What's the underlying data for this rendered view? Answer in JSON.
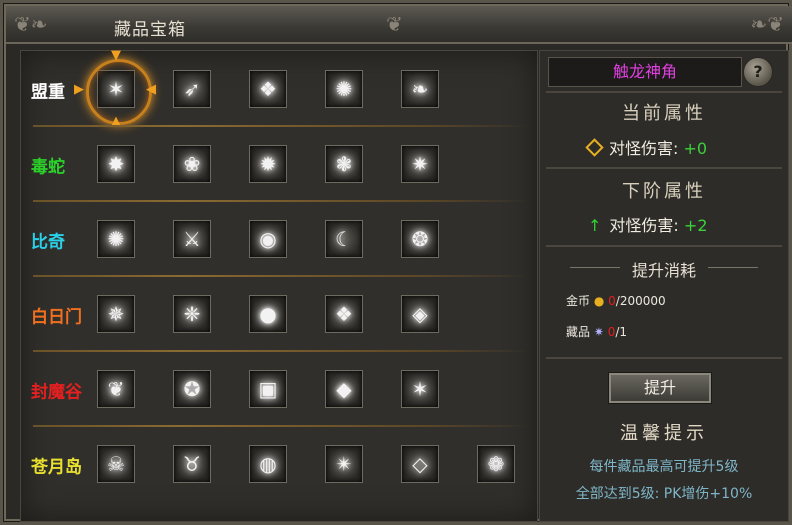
{
  "window": {
    "title": "藏品宝箱"
  },
  "rows": [
    {
      "name": "盟重",
      "color": "#ffffff",
      "items": [
        "✶",
        "➶",
        "❖",
        "✺",
        "❧"
      ],
      "selected": 0
    },
    {
      "name": "毒蛇",
      "color": "#2ad22a",
      "items": [
        "✸",
        "❀",
        "✹",
        "❃",
        "✷"
      ]
    },
    {
      "name": "比奇",
      "color": "#2ad0e8",
      "items": [
        "✺",
        "⚔",
        "◉",
        "☾",
        "❂"
      ]
    },
    {
      "name": "白日门",
      "color": "#f07020",
      "items": [
        "✵",
        "❈",
        "●",
        "❖",
        "◈"
      ]
    },
    {
      "name": "封魔谷",
      "color": "#e62020",
      "items": [
        "❦",
        "✪",
        "▣",
        "◆",
        "✶"
      ]
    },
    {
      "name": "苍月岛",
      "color": "#e8e030",
      "items": [
        "☠",
        "♉",
        "◍",
        "✴",
        "◇",
        "❁"
      ]
    }
  ],
  "panel": {
    "item_name": "触龙神角",
    "help_label": "?",
    "current_header": "当前属性",
    "current_label": "对怪伤害:",
    "current_value": "+0",
    "next_header": "下阶属性",
    "next_label": "对怪伤害:",
    "next_value": "+2",
    "cost_header": "提升消耗",
    "gold_label": "金币",
    "gold_have": "0",
    "gold_need": "/200000",
    "item_label": "藏品",
    "item_have": "0",
    "item_need": "/1",
    "upgrade_label": "提升",
    "tip_header": "温馨提示",
    "tip1": "每件藏品最高可提升5级",
    "tip2": "全部达到5级: PK增伤+10%"
  },
  "colors": {
    "accent_gold": "#c8801c",
    "value_green": "#3ad23a",
    "name_magenta": "#e040e0"
  },
  "icons": {
    "current": "diamond-icon",
    "next": "arrow-up-icon",
    "gold": "gold-coin-icon",
    "item": "sparkle-icon",
    "help": "question-icon"
  }
}
